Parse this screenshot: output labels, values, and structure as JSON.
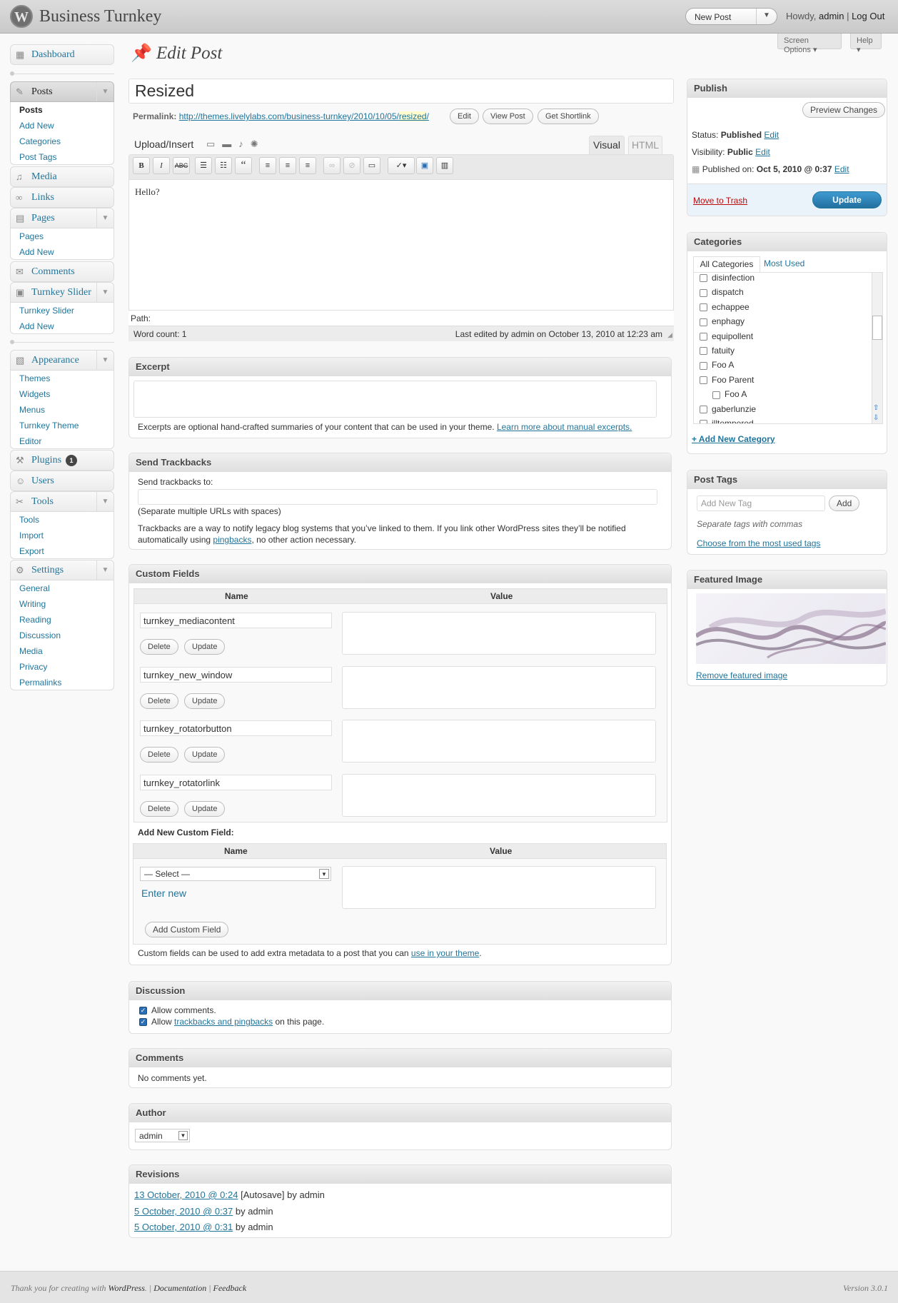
{
  "header": {
    "site_title": "Business Turnkey",
    "favorite_action": "New Post",
    "howdy_prefix": "Howdy,",
    "user": "admin",
    "separator": "|",
    "logout": "Log Out",
    "logo_letter": "W"
  },
  "screen_options": "Screen Options",
  "help": "Help",
  "menu": {
    "dashboard": "Dashboard",
    "posts": "Posts",
    "posts_sub": [
      "Posts",
      "Add New",
      "Categories",
      "Post Tags"
    ],
    "media": "Media",
    "links": "Links",
    "pages": "Pages",
    "pages_sub": [
      "Pages",
      "Add New"
    ],
    "comments": "Comments",
    "turnkey_slider": "Turnkey Slider",
    "slider_sub": [
      "Turnkey Slider",
      "Add New"
    ],
    "appearance": "Appearance",
    "appearance_sub": [
      "Themes",
      "Widgets",
      "Menus",
      "Turnkey Theme",
      "Editor"
    ],
    "plugins": "Plugins",
    "plugins_count": "1",
    "users": "Users",
    "tools": "Tools",
    "tools_sub": [
      "Tools",
      "Import",
      "Export"
    ],
    "settings": "Settings",
    "settings_sub": [
      "General",
      "Writing",
      "Reading",
      "Discussion",
      "Media",
      "Privacy",
      "Permalinks"
    ]
  },
  "page_title": "Edit Post",
  "post_title": "Resized",
  "permalink": {
    "label": "Permalink:",
    "url": "http://themes.livelylabs.com/business-turnkey/2010/10/05/",
    "slug": "resized",
    "trail": "/",
    "edit": "Edit",
    "view": "View Post",
    "shortlink": "Get Shortlink"
  },
  "editor": {
    "upload_insert": "Upload/Insert",
    "tab_visual": "Visual",
    "tab_html": "HTML",
    "content": "Hello?",
    "path": "Path:",
    "word_count": "Word count: 1",
    "last_edited": "Last edited by admin on October 13, 2010 at 12:23 am"
  },
  "excerpt": {
    "title": "Excerpt",
    "help": "Excerpts are optional hand-crafted summaries of your content that can be used in your theme.",
    "link": "Learn more about manual excerpts."
  },
  "trackbacks": {
    "title": "Send Trackbacks",
    "label": "Send trackbacks to:",
    "hint": "(Separate multiple URLs with spaces)",
    "help1": "Trackbacks are a way to notify legacy blog systems that you’ve linked to them. If you link other WordPress sites they’ll be notified",
    "help2_pre": "automatically using",
    "help2_link": "pingbacks",
    "help2_post": ", no other action necessary."
  },
  "custom_fields": {
    "title": "Custom Fields",
    "col_name": "Name",
    "col_value": "Value",
    "fields": [
      "turnkey_mediacontent",
      "turnkey_new_window",
      "turnkey_rotatorbutton",
      "turnkey_rotatorlink"
    ],
    "delete": "Delete",
    "update": "Update",
    "add_new_label": "Add New Custom Field:",
    "select": "— Select —",
    "enter_new": "Enter new",
    "add_button": "Add Custom Field",
    "help_pre": "Custom fields can be used to add extra metadata to a post that you can",
    "help_link": "use in your theme",
    "help_post": "."
  },
  "discussion": {
    "title": "Discussion",
    "allow_comments": "Allow comments.",
    "allow_pre": "Allow",
    "allow_link": "trackbacks and pingbacks",
    "allow_post": "on this page."
  },
  "comments_box": {
    "title": "Comments",
    "text": "No comments yet."
  },
  "author": {
    "title": "Author",
    "value": "admin"
  },
  "revisions": {
    "title": "Revisions",
    "items": [
      {
        "link": "13 October, 2010 @ 0:24",
        "text": "[Autosave] by admin"
      },
      {
        "link": "5 October, 2010 @ 0:37",
        "text": "by admin"
      },
      {
        "link": "5 October, 2010 @ 0:31",
        "text": "by admin"
      }
    ]
  },
  "publish": {
    "title": "Publish",
    "preview": "Preview Changes",
    "status_label": "Status:",
    "status": "Published",
    "visibility_label": "Visibility:",
    "visibility": "Public",
    "published_label": "Published on:",
    "published": "Oct 5, 2010 @ 0:37",
    "edit": "Edit",
    "trash": "Move to Trash",
    "update": "Update"
  },
  "categories": {
    "title": "Categories",
    "tab_all": "All Categories",
    "tab_most": "Most Used",
    "items": [
      "disinfection",
      "dispatch",
      "echappee",
      "enphagy",
      "equipollent",
      "fatuity",
      "Foo A",
      "Foo Parent",
      "Foo A",
      "gaberlunzie",
      "illtempered"
    ],
    "add_new": "+ Add New Category"
  },
  "tags": {
    "title": "Post Tags",
    "placeholder": "Add New Tag",
    "add": "Add",
    "hint": "Separate tags with commas",
    "choose": "Choose from the most used tags"
  },
  "featured": {
    "title": "Featured Image",
    "remove": "Remove featured image"
  },
  "footer": {
    "thanks": "Thank you for creating with",
    "wp": "WordPress",
    "dot": ".",
    "sep": "|",
    "docs": "Documentation",
    "feedback": "Feedback",
    "version": "Version 3.0.1"
  },
  "colors": {
    "link": "#21759b",
    "update_button": "#2a8ab8",
    "trash": "#bc0b0b"
  }
}
